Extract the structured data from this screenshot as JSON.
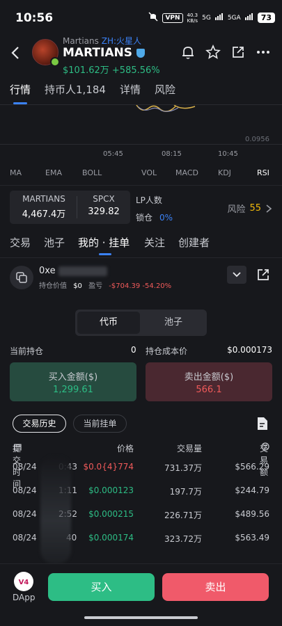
{
  "status_bar": {
    "time": "10:56",
    "vpn": "VPN",
    "speed_value": "40.3",
    "speed_unit": "KB/s",
    "net1": "5G",
    "net2": "5GA",
    "battery": "73"
  },
  "token": {
    "subtitle_name": "Martians",
    "subtitle_zh": "ZH:火星人",
    "name": "MARTIANS",
    "price": "$101.62万",
    "change": "+585.56%"
  },
  "main_tabs": [
    {
      "label": "行情"
    },
    {
      "label": "持币人1,184"
    },
    {
      "label": "详情"
    },
    {
      "label": "风险"
    }
  ],
  "chart": {
    "axis_value": "0.0956",
    "times": [
      "05:45",
      "08:15",
      "10:45"
    ]
  },
  "indicators": [
    "MA",
    "EMA",
    "BOLL",
    "VOL",
    "MACD",
    "KDJ",
    "RSI"
  ],
  "pair": {
    "base_label": "MARTIANS",
    "base_value": "4,467.4万",
    "quote_label": "SPCX",
    "quote_value": "329.82"
  },
  "lp": {
    "label": "LP人数",
    "lock_label": "锁仓",
    "lock_value": "0%"
  },
  "risk": {
    "label": "风险",
    "value": "55"
  },
  "sub_tabs": [
    {
      "label": "交易"
    },
    {
      "label": "池子"
    },
    {
      "label": "我的 · 挂单"
    },
    {
      "label": "关注"
    },
    {
      "label": "创建者"
    }
  ],
  "wallet": {
    "address_prefix": "0xe",
    "holding_label": "持仓价值",
    "holding_value": "$0",
    "pnl_label": "盈亏",
    "pnl_value": "-$704.39 -54.20%"
  },
  "toggle": {
    "left": "代币",
    "right": "池子"
  },
  "position": {
    "current_label": "当前持仓",
    "current_value": "0",
    "cost_label": "持仓成本价",
    "cost_value": "$0.000173"
  },
  "buy_summary": {
    "label": "买入金额($)",
    "value": "1,299.61"
  },
  "sell_summary": {
    "label": "卖出金额($)",
    "value": "566.1"
  },
  "history_tabs": {
    "history": "交易历史",
    "pending": "当前挂单"
  },
  "table": {
    "headers": {
      "time": "提交时间",
      "price": "价格",
      "amount": "交易量",
      "total": "交易额"
    },
    "rows": [
      {
        "date": "08/24",
        "time": "0:43",
        "price": "$0.0{4}774",
        "side": "sell",
        "amount": "731.37万",
        "total": "$566.29"
      },
      {
        "date": "08/24",
        "time": "1:11",
        "price": "$0.000123",
        "side": "buy",
        "amount": "197.7万",
        "total": "$244.79"
      },
      {
        "date": "08/24",
        "time": "2:52",
        "price": "$0.000215",
        "side": "buy",
        "amount": "226.71万",
        "total": "$489.56"
      },
      {
        "date": "08/24",
        "time": "40",
        "price": "$0.000174",
        "side": "buy",
        "amount": "323.72万",
        "total": "$563.49"
      }
    ]
  },
  "bottom": {
    "dapp_label": "DApp",
    "buy": "买入",
    "sell": "卖出"
  }
}
